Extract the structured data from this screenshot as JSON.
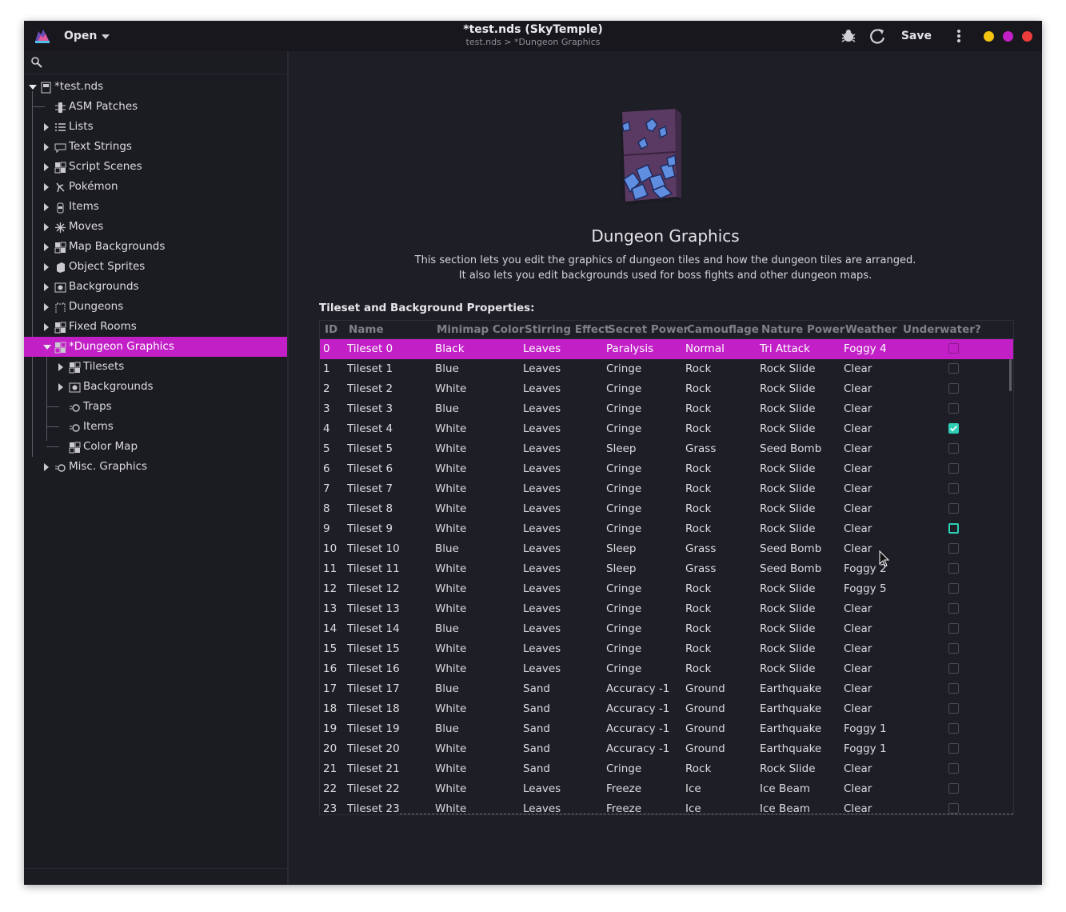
{
  "headerbar": {
    "open_label": "Open",
    "title": "*test.nds (SkyTemple)",
    "subtitle": "test.nds > *Dungeon Graphics",
    "save_label": "Save",
    "window_buttons": [
      "#f2c40f",
      "#c21fc7",
      "#ee3b3b"
    ]
  },
  "sidebar": {
    "items": [
      {
        "label": "*test.nds",
        "icon": "rom-icon"
      },
      {
        "label": "ASM Patches",
        "icon": "patch-icon"
      },
      {
        "label": "Lists",
        "icon": "list-icon"
      },
      {
        "label": "Text Strings",
        "icon": "speech-bubble-icon"
      },
      {
        "label": "Script Scenes",
        "icon": "scene-icon"
      },
      {
        "label": "Pokémon",
        "icon": "pokemon-icon"
      },
      {
        "label": "Items",
        "icon": "item-icon"
      },
      {
        "label": "Moves",
        "icon": "move-icon"
      },
      {
        "label": "Map Backgrounds",
        "icon": "map-bg-icon"
      },
      {
        "label": "Object Sprites",
        "icon": "object-icon"
      },
      {
        "label": "Backgrounds",
        "icon": "background-icon"
      },
      {
        "label": "Dungeons",
        "icon": "dungeon-icon"
      },
      {
        "label": "Fixed Rooms",
        "icon": "fixed-room-icon"
      },
      {
        "label": "*Dungeon Graphics",
        "icon": "dungeon-graphics-icon"
      },
      {
        "label": "Tilesets",
        "icon": "tileset-icon"
      },
      {
        "label": "Backgrounds",
        "icon": "background-icon"
      },
      {
        "label": "Traps",
        "icon": "trap-icon"
      },
      {
        "label": "Items",
        "icon": "trap-icon"
      },
      {
        "label": "Color Map",
        "icon": "tileset-icon"
      },
      {
        "label": "Misc. Graphics",
        "icon": "trap-icon"
      }
    ]
  },
  "main": {
    "heading": "Dungeon Graphics",
    "desc_line1": "This section lets you edit the graphics of dungeon tiles and how the dungeon tiles are arranged.",
    "desc_line2": "It also lets you edit backgrounds used for boss fights and other dungeon maps.",
    "section_label": "Tileset and Background Properties:",
    "columns": [
      "ID",
      "Name",
      "Minimap Color",
      "Stirring Effect",
      "Secret Power",
      "Camouflage",
      "Nature Power",
      "Weather",
      "Underwater?"
    ],
    "rows": [
      [
        "0",
        "Tileset 0",
        "Black",
        "Leaves",
        "Paralysis",
        "Normal",
        "Tri Attack",
        "Foggy 4"
      ],
      [
        "1",
        "Tileset 1",
        "Blue",
        "Leaves",
        "Cringe",
        "Rock",
        "Rock Slide",
        "Clear"
      ],
      [
        "2",
        "Tileset 2",
        "White",
        "Leaves",
        "Cringe",
        "Rock",
        "Rock Slide",
        "Clear"
      ],
      [
        "3",
        "Tileset 3",
        "Blue",
        "Leaves",
        "Cringe",
        "Rock",
        "Rock Slide",
        "Clear"
      ],
      [
        "4",
        "Tileset 4",
        "White",
        "Leaves",
        "Cringe",
        "Rock",
        "Rock Slide",
        "Clear"
      ],
      [
        "5",
        "Tileset 5",
        "White",
        "Leaves",
        "Sleep",
        "Grass",
        "Seed Bomb",
        "Clear"
      ],
      [
        "6",
        "Tileset 6",
        "White",
        "Leaves",
        "Cringe",
        "Rock",
        "Rock Slide",
        "Clear"
      ],
      [
        "7",
        "Tileset 7",
        "White",
        "Leaves",
        "Cringe",
        "Rock",
        "Rock Slide",
        "Clear"
      ],
      [
        "8",
        "Tileset 8",
        "White",
        "Leaves",
        "Cringe",
        "Rock",
        "Rock Slide",
        "Clear"
      ],
      [
        "9",
        "Tileset 9",
        "White",
        "Leaves",
        "Cringe",
        "Rock",
        "Rock Slide",
        "Clear"
      ],
      [
        "10",
        "Tileset 10",
        "Blue",
        "Leaves",
        "Sleep",
        "Grass",
        "Seed Bomb",
        "Clear"
      ],
      [
        "11",
        "Tileset 11",
        "White",
        "Leaves",
        "Sleep",
        "Grass",
        "Seed Bomb",
        "Foggy 2"
      ],
      [
        "12",
        "Tileset 12",
        "White",
        "Leaves",
        "Cringe",
        "Rock",
        "Rock Slide",
        "Foggy 5"
      ],
      [
        "13",
        "Tileset 13",
        "White",
        "Leaves",
        "Cringe",
        "Rock",
        "Rock Slide",
        "Clear"
      ],
      [
        "14",
        "Tileset 14",
        "Blue",
        "Leaves",
        "Cringe",
        "Rock",
        "Rock Slide",
        "Clear"
      ],
      [
        "15",
        "Tileset 15",
        "White",
        "Leaves",
        "Cringe",
        "Rock",
        "Rock Slide",
        "Clear"
      ],
      [
        "16",
        "Tileset 16",
        "White",
        "Leaves",
        "Cringe",
        "Rock",
        "Rock Slide",
        "Clear"
      ],
      [
        "17",
        "Tileset 17",
        "Blue",
        "Sand",
        "Accuracy -1",
        "Ground",
        "Earthquake",
        "Clear"
      ],
      [
        "18",
        "Tileset 18",
        "White",
        "Sand",
        "Accuracy -1",
        "Ground",
        "Earthquake",
        "Clear"
      ],
      [
        "19",
        "Tileset 19",
        "Blue",
        "Sand",
        "Accuracy -1",
        "Ground",
        "Earthquake",
        "Foggy 1"
      ],
      [
        "20",
        "Tileset 20",
        "White",
        "Sand",
        "Accuracy -1",
        "Ground",
        "Earthquake",
        "Foggy 1"
      ],
      [
        "21",
        "Tileset 21",
        "White",
        "Sand",
        "Cringe",
        "Rock",
        "Rock Slide",
        "Clear"
      ],
      [
        "22",
        "Tileset 22",
        "White",
        "Leaves",
        "Freeze",
        "Ice",
        "Ice Beam",
        "Clear"
      ],
      [
        "23",
        "Tileset 23",
        "White",
        "Leaves",
        "Freeze",
        "Ice",
        "Ice Beam",
        "Clear"
      ]
    ],
    "underwater": [
      false,
      false,
      false,
      false,
      true,
      false,
      false,
      false,
      false,
      false,
      false,
      false,
      false,
      false,
      false,
      false,
      false,
      false,
      false,
      false,
      false,
      false,
      false,
      false
    ],
    "selected_row": 0,
    "focused_checkbox_row": 9
  },
  "colors": {
    "accent": "#c21fc7",
    "check": "#2ecfb6"
  }
}
